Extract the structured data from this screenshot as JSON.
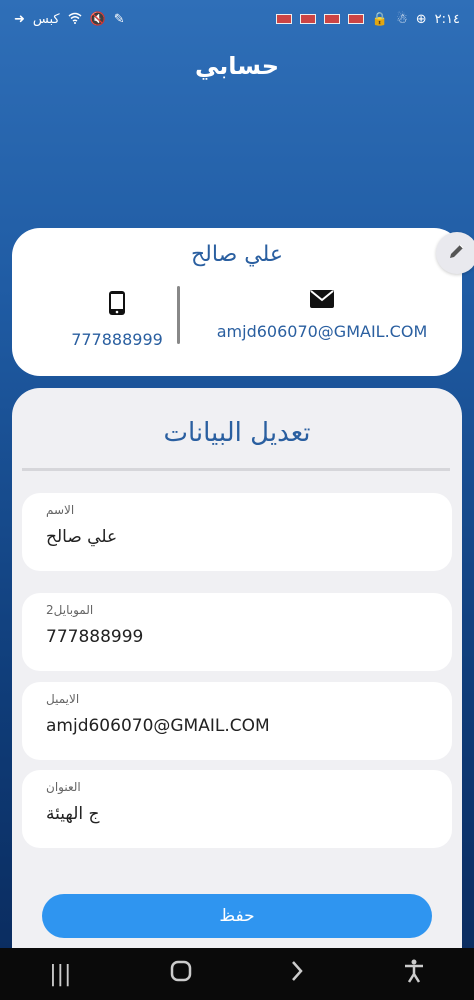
{
  "status": {
    "time": "٢:١٤",
    "network_speed": "كبس"
  },
  "header": {
    "title": "حسابي"
  },
  "profile": {
    "name": "علي صالح",
    "phone": "777888999",
    "email": "amjd606070@GMAIL.COM"
  },
  "form": {
    "title": "تعديل البيانات",
    "fields": [
      {
        "label": "الاسم",
        "value": "علي صالح"
      },
      {
        "label": "الموبايل2",
        "value": "777888999"
      },
      {
        "label": "الايميل",
        "value": "amjd606070@GMAIL.COM"
      },
      {
        "label": "العنوان",
        "value": "ج الهيئة"
      }
    ],
    "save_label": "حفظ"
  },
  "colors": {
    "accent": "#2f95f0",
    "text_blue": "#2a5fa0",
    "gradient_top": "#2f6fb8",
    "gradient_bottom": "#0a2a5c"
  },
  "icons": {
    "phone": "phone-icon",
    "email": "mail-icon",
    "edit": "pencil-icon"
  }
}
